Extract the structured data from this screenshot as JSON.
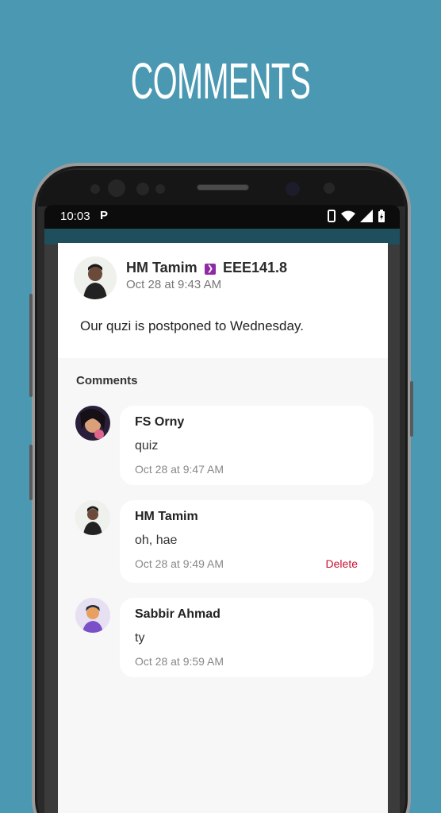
{
  "banner": {
    "title": "COMMENTS"
  },
  "status_bar": {
    "time": "10:03",
    "app_icon": "P"
  },
  "post": {
    "author": "HM Tamim",
    "class": "EEE141.8",
    "time": "Oct 28 at 9:43 AM",
    "body": "Our quzi is postponed to Wednesday."
  },
  "comments": {
    "heading": "Comments",
    "items": [
      {
        "author": "FS Orny",
        "text": "quiz",
        "time": "Oct 28 at 9:47 AM"
      },
      {
        "author": "HM Tamim",
        "text": "oh, hae",
        "time": "Oct 28 at 9:49 AM",
        "delete_label": "Delete"
      },
      {
        "author": "Sabbir Ahmad",
        "text": "ty",
        "time": "Oct 28 at 9:59 AM"
      }
    ]
  },
  "colors": {
    "background": "#4a98b1",
    "delete": "#c8102e",
    "badge": "#8e2aa6"
  }
}
